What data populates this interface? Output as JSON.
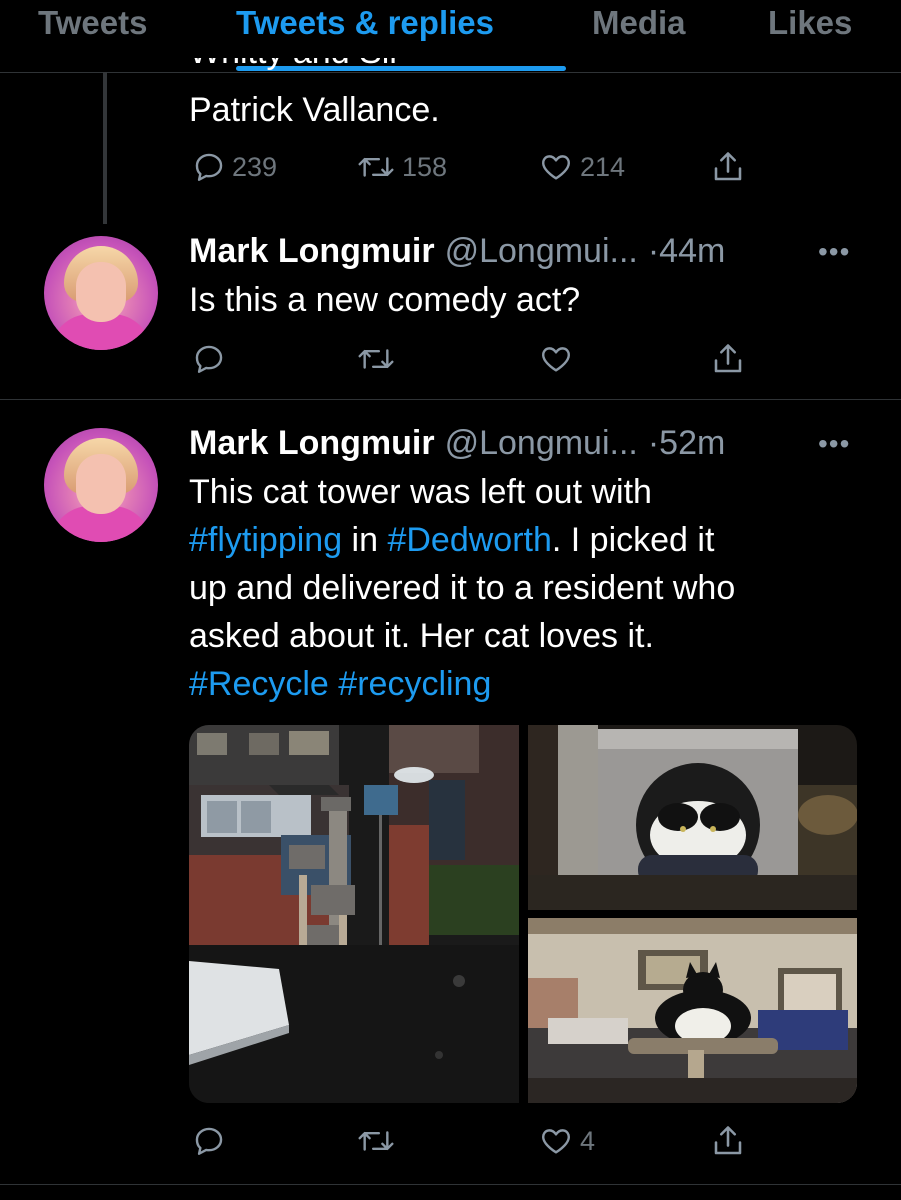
{
  "tabs": [
    "Tweets",
    "Tweets & replies",
    "Media",
    "Likes"
  ],
  "active_tab": "Tweets & replies",
  "previous_tweet": {
    "clipped_text": "Whitty and Sir",
    "last_line": "Patrick Vallance.",
    "replies": "239",
    "retweets": "158",
    "likes": "214"
  },
  "tweets": [
    {
      "name": "Mark Longmuir",
      "handle": "@Longmui...",
      "time": "·44m",
      "text": "Is this a new comedy act?",
      "replies": "",
      "retweets": "",
      "likes": ""
    },
    {
      "name": "Mark Longmuir",
      "handle": "@Longmui...",
      "time": "·52m",
      "lines": [
        [
          {
            "t": "This cat tower was left out with",
            "link": false
          }
        ],
        [
          {
            "t": "#flytipping",
            "link": true
          },
          {
            "t": " in ",
            "link": false
          },
          {
            "t": "#Dedworth",
            "link": true
          },
          {
            "t": ". I picked it",
            "link": false
          }
        ],
        [
          {
            "t": "up and delivered it to a resident who",
            "link": false
          }
        ],
        [
          {
            "t": "asked about it. Her cat loves it.",
            "link": false
          }
        ],
        [
          {
            "t": "#Recycle",
            "link": true
          },
          {
            "t": " ",
            "link": false
          },
          {
            "t": "#recycling",
            "link": true
          }
        ]
      ],
      "replies": "",
      "retweets": "",
      "likes": "4"
    }
  ],
  "icons": {
    "reply": "reply-icon",
    "retweet": "retweet-icon",
    "like": "heart-icon",
    "share": "share-icon",
    "more": "more-icon"
  },
  "colors": {
    "background": "#000000",
    "accent": "#1d9bf0",
    "muted": "#6e767d",
    "divider": "#2f3336"
  }
}
